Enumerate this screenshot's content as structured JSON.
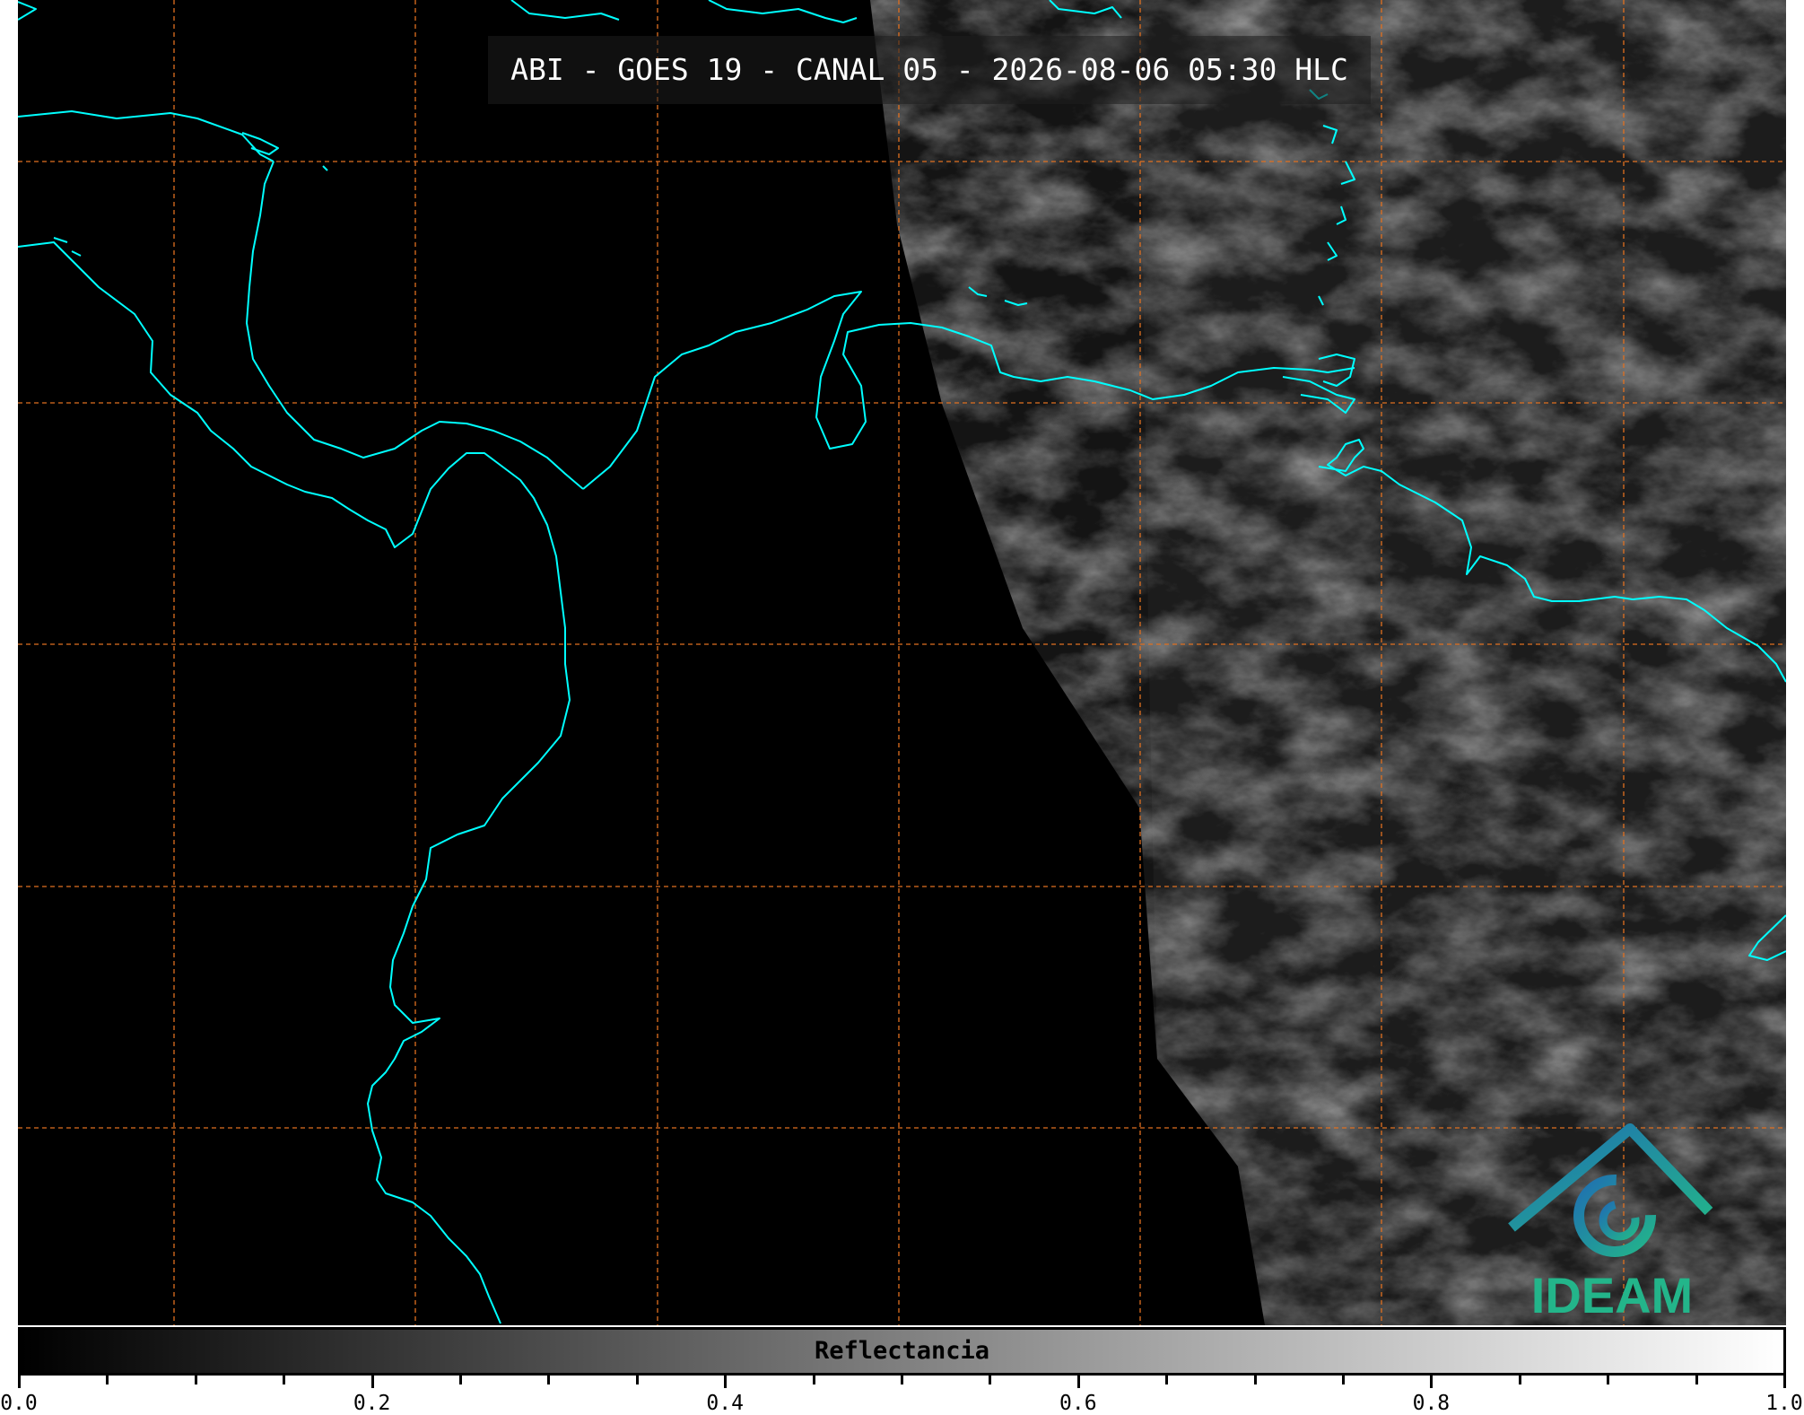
{
  "title": "ABI - GOES 19 - CANAL 05 - 2026-08-06 05:30 HLC",
  "colorbar": {
    "label": "Reflectancia",
    "min": 0.0,
    "max": 1.0,
    "ticks": [
      "0.0",
      "0.2",
      "0.4",
      "0.6",
      "0.8",
      "1.0"
    ],
    "minor_ticks_between": 3
  },
  "logo": {
    "text": "IDEAM",
    "colors": [
      "#1f6fb2",
      "#23b58a"
    ]
  },
  "style": {
    "coastline_color": "#00ffff",
    "grid_color": "#e07020",
    "background_color": "#000000",
    "cloud_color": "#4a4a4a"
  }
}
